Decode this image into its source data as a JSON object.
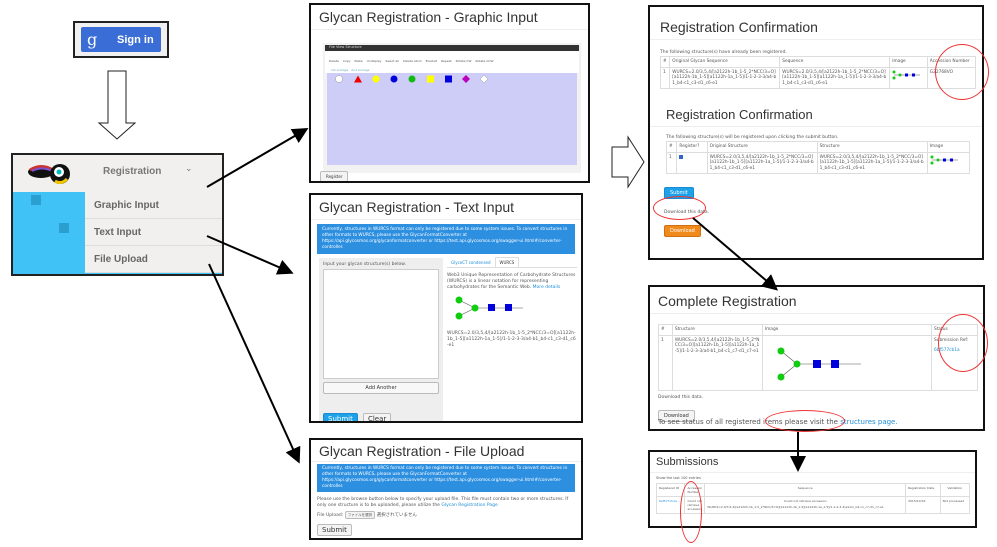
{
  "signin": {
    "label": "Sign in",
    "logo": "g",
    "color": "#3a6ed6"
  },
  "menu": {
    "title": "Registration",
    "chevron": "⌄",
    "items": [
      "Graphic Input",
      "Text Input",
      "File Upload"
    ],
    "accent": "#41c2f6"
  },
  "graphic": {
    "title": "Glycan Registration - Graphic Input",
    "menubar": [
      "File",
      "View",
      "Structure"
    ],
    "tools": [
      "Delete",
      "Copy",
      "Paste",
      "Undisplay",
      "Select all",
      "Delete atom",
      "Bracket",
      "Repeat",
      "Rotate CW",
      "Rotate CCW"
    ],
    "subtabs": [
      "1st Linkage",
      "2nd Linkage"
    ],
    "register": "Register",
    "canvas_color": "#cdcdf8"
  },
  "text": {
    "title": "Glycan Registration - Text Input",
    "alert": "Currently, structures in WURCS format can only be registered due to some system issues. To convert structures in other formats to WURCS, please use the GlycanFormatConverter at https://api.glycosmos.org/glycanformatconverter or https://test.api.glycosmos.org/swagger-ui.html#/converter-controller.",
    "input_label": "Input your glycan structure(s) below.",
    "add_another": "Add Another",
    "submit": "Submit",
    "clear": "Clear",
    "tabs": [
      "GlycoCT condensed",
      "WURCS"
    ],
    "desc": "Web3 Unique Representation of Carbohydrate Structures (WURCS) is a linear notation for representing carbohydrates for the Semantic Web.",
    "more": "More details",
    "example": "WURCS=2.0/3,5,4/[a2122h-1b_1-5_2*NCC/3=O][a1122h-1b_1-5][a1122h-1a_1-5]/1-1-2-3-3/a4-b1_b4-c1_c3-d1_c6-e1"
  },
  "upload": {
    "title": "Glycan Registration - File Upload",
    "alert": "Currently, structures in WURCS format can only be registered due to some system issues. To convert structures in other formats to WURCS, please use the GlycanFormatConverter at https://api.glycosmos.org/glycanformatconverter or https://test.api.glycosmos.org/swagger-ui.html#/converter-controller.",
    "instructions": "Please use the browse button below to specify your upload file. This file must contain two or more structures. If only one structure is to be uploaded, please utilize the",
    "instructions_link": "Glycan Registration Page",
    "file_label": "File Upload:",
    "file_button": "ファイルを選択",
    "file_status": "選択されていません",
    "submit": "Submit"
  },
  "confirm": {
    "title": "Registration Confirmation",
    "registered_note": "The following structure(s) have already been registered.",
    "headers1": [
      "#",
      "Original Glycan Sequence",
      "Sequence",
      "Image",
      "Accession Number"
    ],
    "row1": [
      "1",
      "WURCS=2.0/3,5,4/[a2122h-1b_1-5_2*NCC/3=O][a1122h-1b_1-5][a1122h-1a_1-5]/1-1-2-3-3/a4-b1_b4-c1_c3-d1_c6-e1",
      "WURCS=2.0/3,5,4/[a2122h-1b_1-5_2*NCC/3=O][a1122h-1b_1-5][a1122h-1a_1-5]/1-1-2-3-3/a4-b1_b4-c1_c3-d1_c6-e1",
      "",
      "G22768VO"
    ],
    "title2": "Registration Confirmation",
    "will_note": "The following structure(s) will be registered upon clicking the submit button.",
    "headers2": [
      "#",
      "Register?",
      "Original Structure",
      "Structure",
      "Image"
    ],
    "row2": [
      "1",
      "",
      "WURCS=2.0/3,5,4/[a2122h-1b_1-5_2*NCC/3=O][a1122h-1b_1-5][a1122h-1a_1-5]/1-1-2-3-3/a4-b1_b4-c1_c3-d1_c6-e1",
      "WURCS=2.0/3,5,4/[a2122h-1b_1-5_2*NCC/3=O][a1122h-1b_1-5][a1122h-1a_1-5]/1-1-2-3-3/a4-b1_b4-c1_c3-d1_c6-e1",
      ""
    ],
    "submit": "Submit",
    "download_note": "Download this data.",
    "download": "Download"
  },
  "complete": {
    "title": "Complete Registration",
    "headers": [
      "#",
      "Structure",
      "Image",
      "Status"
    ],
    "row": [
      "1",
      "WURCS=2.0/3,5,4/[a2122h-1b_1-5_2*NCC/3=O][a1122h-1b_1-5][a1122h-1a_1-5]/1-1-2-3-3/a4-b1_b4-c1_c7-d1_c7-e1"
    ],
    "status": "Submission Ref:",
    "ref": "6bf577cb1a",
    "download_note": "Download this data.",
    "download": "Download",
    "footer": "To see status of all registered items please visit the",
    "footer_link": "structures page."
  },
  "submissions": {
    "title": "Submissions",
    "note": "Show the last 100 entries",
    "headers": [
      "Registered ID",
      "Accession Number",
      "Sequence",
      "Registration Date",
      "Validation"
    ],
    "row": [
      "6af577cb1a...",
      "Could not retrieve accession",
      "Could not retrieve accession",
      "2015/10/16",
      "Not processed"
    ],
    "sequence": "WURCS=2.0/3,5,4/[a2122h-1b_1-5_2*NCC/3=O][a1122h-1b_1-5][a1122h-1a_1-5]/1-1-2-3-3/a4-b1_b4-c1_c7-d1_c7-e1"
  }
}
